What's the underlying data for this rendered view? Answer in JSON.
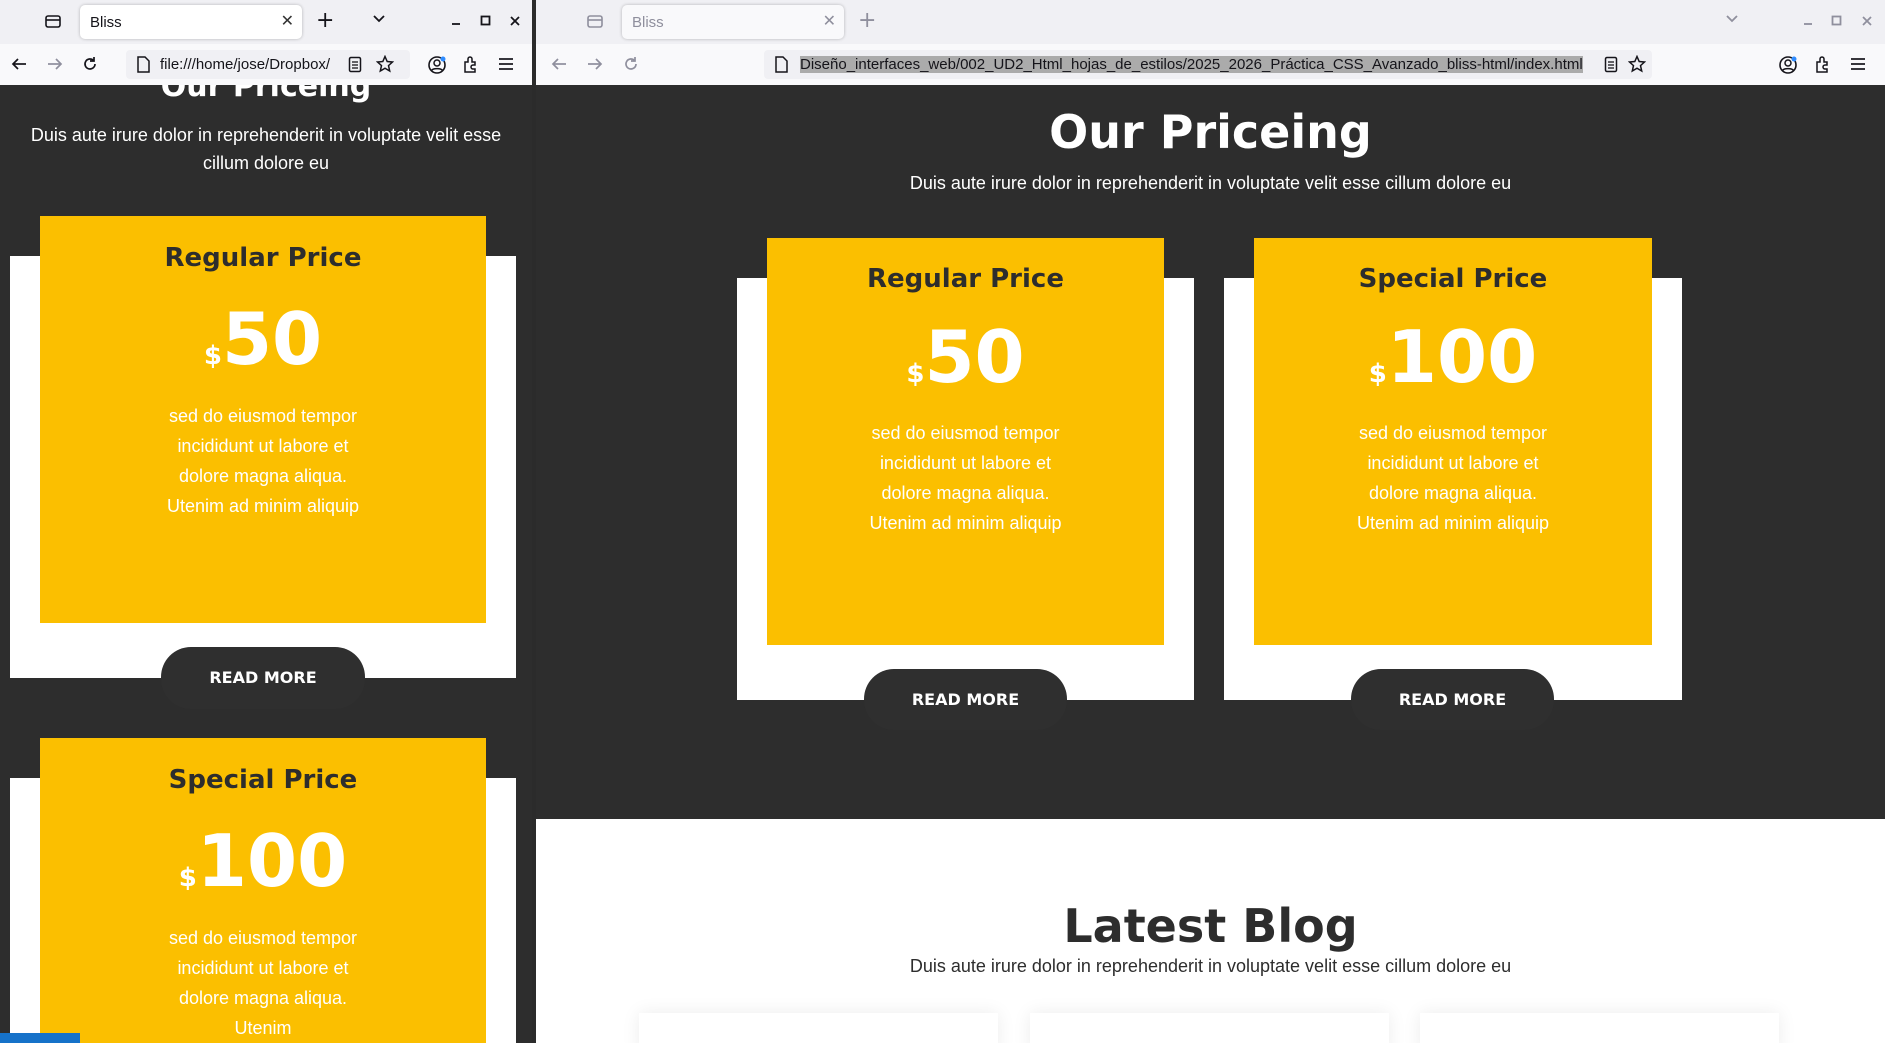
{
  "left_window": {
    "tab_title": "Bliss",
    "url": "file:///home/jose/Dropbox/",
    "section_title": "Our Priceing",
    "section_subtitle": "Duis aute irure dolor in reprehenderit in voluptate velit esse cillum dolore eu",
    "cards": [
      {
        "title": "Regular Price",
        "currency": "$",
        "amount": "50",
        "description": "sed do eiusmod tempor incididunt ut labore et dolore magna aliqua. Utenim ad minim aliquip",
        "button": "READ MORE"
      },
      {
        "title": "Special Price",
        "currency": "$",
        "amount": "100",
        "description": "sed do eiusmod tempor incididunt ut labore et dolore magna aliqua. Utenim",
        "button": ""
      }
    ]
  },
  "right_window": {
    "tab_title": "Bliss",
    "url": "Diseño_interfaces_web/002_UD2_Html_hojas_de_estilos/2025_2026_Práctica_CSS_Avanzado_bliss-html/index.html",
    "section_title": "Our Priceing",
    "section_subtitle": "Duis aute irure dolor in reprehenderit in voluptate velit esse cillum dolore eu",
    "cards": [
      {
        "title": "Regular Price",
        "currency": "$",
        "amount": "50",
        "description": "sed do eiusmod tempor incididunt ut labore et dolore magna aliqua. Utenim ad minim aliquip",
        "button": "READ MORE"
      },
      {
        "title": "Special Price",
        "currency": "$",
        "amount": "100",
        "description": "sed do eiusmod tempor incididunt ut labore et dolore magna aliqua. Utenim ad minim aliquip",
        "button": "READ MORE"
      }
    ],
    "blog_title": "Latest Blog",
    "blog_subtitle": "Duis aute irure dolor in reprehenderit in voluptate velit esse cillum dolore eu"
  },
  "colors": {
    "page_dark": "#2d2d2d",
    "card_yellow": "#fbbf00",
    "button_dark": "#2f2f2f",
    "white": "#ffffff"
  },
  "icons": [
    "tab-list-icon",
    "new-tab-icon",
    "chevron-down-icon",
    "minimize-icon",
    "maximize-icon",
    "close-icon",
    "back-icon",
    "forward-icon",
    "reload-icon",
    "page-icon",
    "reader-mode-icon",
    "bookmark-star-icon",
    "account-icon",
    "extensions-icon",
    "menu-icon"
  ]
}
